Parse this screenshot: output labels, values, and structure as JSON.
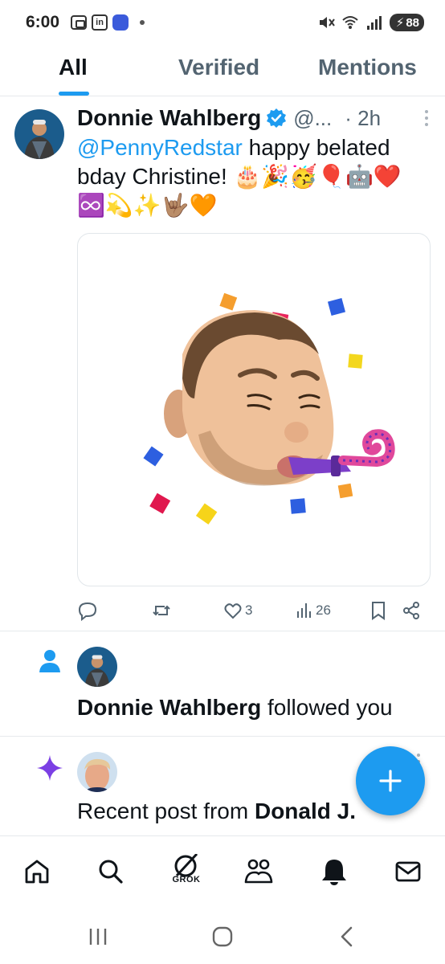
{
  "status_bar": {
    "time": "6:00",
    "linkedin_label": "in",
    "battery": "88"
  },
  "tabs": [
    {
      "label": "All"
    },
    {
      "label": "Verified"
    },
    {
      "label": "Mentions"
    }
  ],
  "tweet": {
    "author": "Donnie Wahlberg",
    "handle": "@...",
    "time": "· 2h",
    "mention": "@PennyRedstar",
    "text": " happy belated bday Christine! 🎂🎉🥳🎈🤖❤️♾️💫✨🤟🏽🧡",
    "stats": {
      "reply_count": "",
      "retweet_count": "",
      "like_count": "3",
      "view_count": "26"
    }
  },
  "notifications": [
    {
      "actor": "Donnie Wahlberg",
      "text": " followed you"
    },
    {
      "prefix": "Recent post from ",
      "actor": "Donald J."
    }
  ],
  "bottom_nav": {
    "grok_label": "GROK"
  },
  "colors": {
    "accent": "#1d9bf0",
    "text": "#0f1419",
    "secondary": "#536471",
    "grok_star": "#7b3fe4"
  },
  "icons": [
    "home-icon",
    "search-icon",
    "grok-icon",
    "communities-icon",
    "notifications-icon",
    "messages-icon"
  ]
}
